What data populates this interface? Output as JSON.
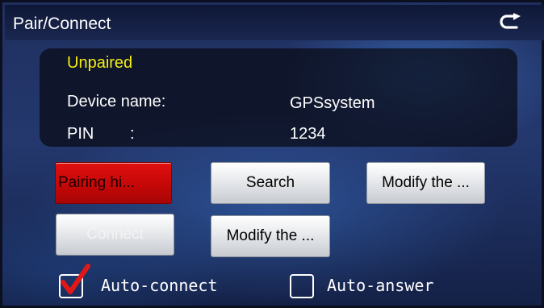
{
  "window": {
    "title": "Pair/Connect"
  },
  "info": {
    "status": "Unpaired",
    "device_name_label": "Device name:",
    "device_name_value": "GPSsystem",
    "pin_label": "PIN",
    "pin_colon": ":",
    "pin_value": "1234"
  },
  "buttons": {
    "pairing_hint": "Pairing hi...",
    "search": "Search",
    "modify_1": "Modify the ...",
    "connect": "Connect",
    "modify_2": "Modify the ..."
  },
  "options": {
    "auto_connect": {
      "label": "Auto-connect",
      "checked": true
    },
    "auto_answer": {
      "label": "Auto-answer",
      "checked": false
    }
  },
  "colors": {
    "status": "#f5ee13",
    "alert_button": "#d10a0a",
    "check_mark": "#e01818"
  },
  "icons": {
    "back": "back-arrow-icon",
    "check": "checkmark-icon"
  }
}
